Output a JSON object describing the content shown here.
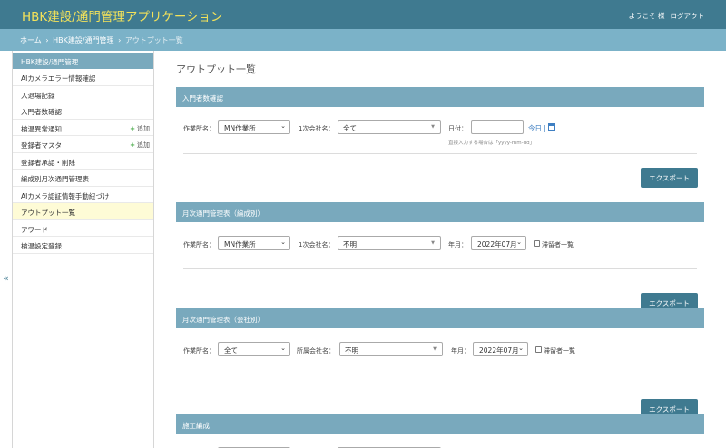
{
  "header": {
    "title": "HBK建設/通門管理アプリケーション",
    "welcome": "ようこそ 様",
    "logout": "ログアウト"
  },
  "breadcrumb": {
    "home": "ホーム",
    "section": "HBK建設/通門管理",
    "current": "アウトプット一覧",
    "sep": "›"
  },
  "sidebar": {
    "collapse_glyph": "«",
    "header": "HBK建設/通門管理",
    "items": [
      {
        "label": "AIカメラエラー情報確認"
      },
      {
        "label": "入退場記録"
      },
      {
        "label": "入門者数確認"
      },
      {
        "label": "検温異常通知",
        "add": "追加"
      },
      {
        "label": "登録者マスタ",
        "add": "追加"
      },
      {
        "label": "登録者承認・削除"
      },
      {
        "label": "編成別月次通門管理表"
      },
      {
        "label": "AIカメラ認証情報手動紐づけ"
      },
      {
        "label": "アウトプット一覧"
      },
      {
        "label": "アワード"
      },
      {
        "label": "検温設定登録"
      }
    ],
    "active_index": 8
  },
  "main": {
    "page_title": "アウトプット一覧",
    "export_label": "エクスポート",
    "panels": [
      {
        "title": "入門者数確認",
        "site_label": "作業所名：",
        "site_value": "MN作業所",
        "company_label": "1次会社名：",
        "company_value": "全て",
        "date_label": "日付：",
        "date_value": "",
        "today_label": "今日 |",
        "date_hint": "直接入力する場合は「yyyy-mm-dd」"
      },
      {
        "title": "月次通門管理表（編成別）",
        "site_label": "作業所名：",
        "site_value": "MN作業所",
        "company_label": "1次会社名：",
        "company_value": "不明",
        "month_label": "年月：",
        "month_value": "2022年07月",
        "checkbox_label": "滞留者一覧"
      },
      {
        "title": "月次通門管理表（会社別）",
        "site_label": "作業所名：",
        "site_value": "全て",
        "company_label": "所属会社名：",
        "company_value": "不明",
        "month_label": "年月：",
        "month_value": "2022年07月",
        "checkbox_label": "滞留者一覧"
      },
      {
        "title": "施工編成"
      }
    ]
  },
  "colors": {
    "header_bg": "#3f7a90",
    "title_yellow": "#f3e25a",
    "crumb_bg": "#7bb2c8",
    "panel_head": "#79a9bd",
    "button": "#3f7a90",
    "active_bg": "#fefbd6",
    "add_plus": "#39a33a"
  }
}
